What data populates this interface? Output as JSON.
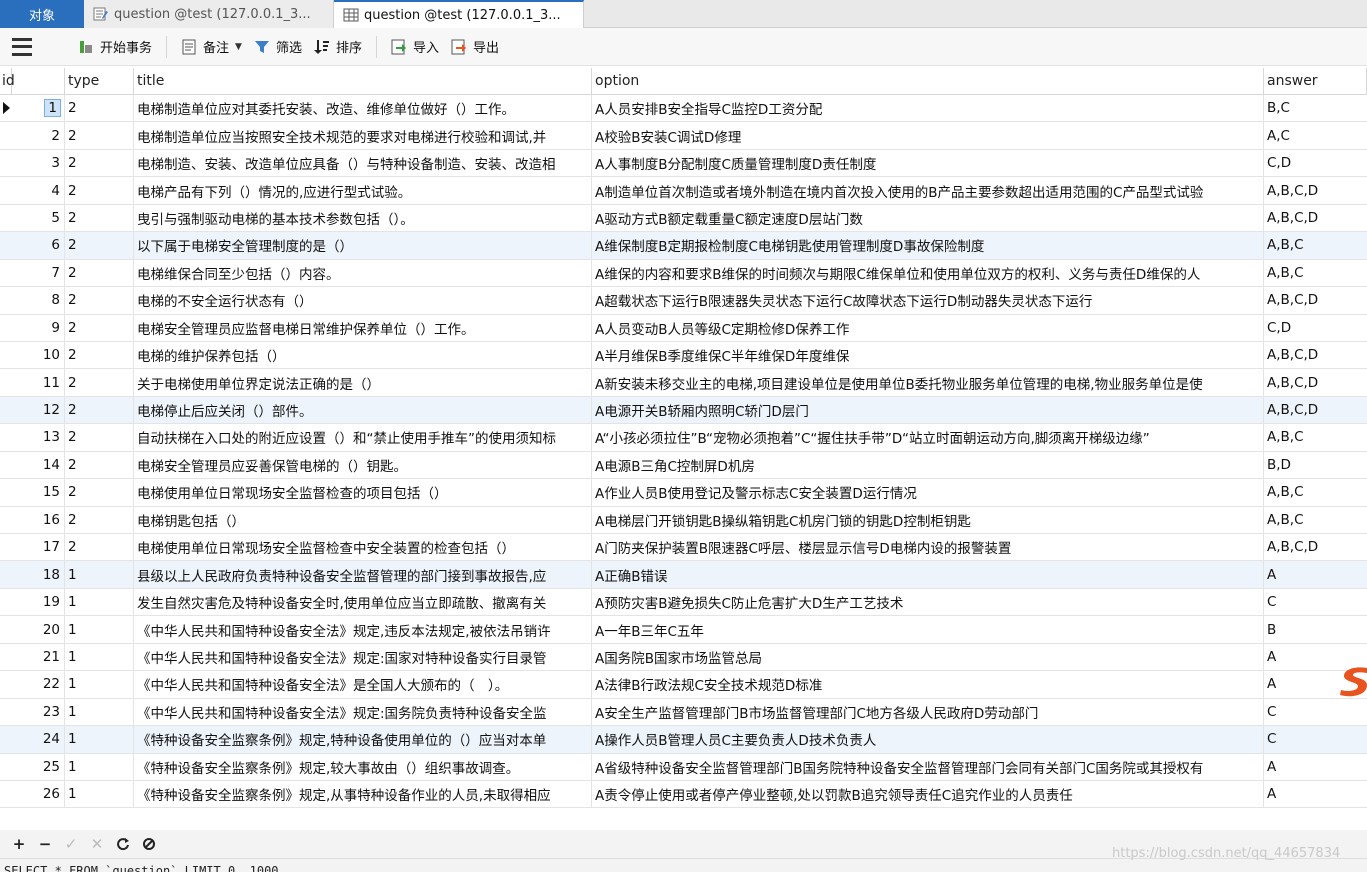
{
  "tabs": [
    {
      "label": "对象"
    },
    {
      "label": "question @test (127.0.0.1_3..."
    },
    {
      "label": "question @test (127.0.0.1_3..."
    }
  ],
  "toolbar": {
    "begin_transaction": "开始事务",
    "memo": "备注",
    "filter": "筛选",
    "sort": "排序",
    "import": "导入",
    "export": "导出"
  },
  "columns": [
    "id",
    "type",
    "title",
    "option",
    "answer"
  ],
  "rows": [
    {
      "id": "1",
      "type": "2",
      "title": "电梯制造单位应对其委托安装、改造、维修单位做好（）工作。",
      "option": "A人员安排B安全指导C监控D工资分配",
      "answer": "B,C"
    },
    {
      "id": "2",
      "type": "2",
      "title": "电梯制造单位应当按照安全技术规范的要求对电梯进行校验和调试,并",
      "option": "A校验B安装C调试D修理",
      "answer": "A,C"
    },
    {
      "id": "3",
      "type": "2",
      "title": "电梯制造、安装、改造单位应具备（）与特种设备制造、安装、改造相",
      "option": "A人事制度B分配制度C质量管理制度D责任制度",
      "answer": "C,D"
    },
    {
      "id": "4",
      "type": "2",
      "title": "电梯产品有下列（）情况的,应进行型式试验。",
      "option": "A制造单位首次制造或者境外制造在境内首次投入使用的B产品主要参数超出适用范围的C产品型式试验",
      "answer": "A,B,C,D"
    },
    {
      "id": "5",
      "type": "2",
      "title": "曳引与强制驱动电梯的基本技术参数包括（）。",
      "option": "A驱动方式B额定载重量C额定速度D层站门数",
      "answer": "A,B,C,D"
    },
    {
      "id": "6",
      "type": "2",
      "title": "以下属于电梯安全管理制度的是（）",
      "option": "A维保制度B定期报检制度C电梯钥匙使用管理制度D事故保险制度",
      "answer": "A,B,C"
    },
    {
      "id": "7",
      "type": "2",
      "title": "电梯维保合同至少包括（）内容。",
      "option": "A维保的内容和要求B维保的时间频次与期限C维保单位和使用单位双方的权利、义务与责任D维保的人",
      "answer": "A,B,C"
    },
    {
      "id": "8",
      "type": "2",
      "title": "电梯的不安全运行状态有（）",
      "option": "A超载状态下运行B限速器失灵状态下运行C故障状态下运行D制动器失灵状态下运行",
      "answer": "A,B,C,D"
    },
    {
      "id": "9",
      "type": "2",
      "title": "电梯安全管理员应监督电梯日常维护保养单位（）工作。",
      "option": "A人员变动B人员等级C定期检修D保养工作",
      "answer": "C,D"
    },
    {
      "id": "10",
      "type": "2",
      "title": "电梯的维护保养包括（）",
      "option": "A半月维保B季度维保C半年维保D年度维保",
      "answer": "A,B,C,D"
    },
    {
      "id": "11",
      "type": "2",
      "title": "关于电梯使用单位界定说法正确的是（）",
      "option": "A新安装未移交业主的电梯,项目建设单位是使用单位B委托物业服务单位管理的电梯,物业服务单位是使",
      "answer": "A,B,C,D"
    },
    {
      "id": "12",
      "type": "2",
      "title": "电梯停止后应关闭（）部件。",
      "option": "A电源开关B轿厢内照明C轿门D层门",
      "answer": "A,B,C,D"
    },
    {
      "id": "13",
      "type": "2",
      "title": "自动扶梯在入口处的附近应设置（）和“禁止使用手推车”的使用须知标",
      "option": "A“小孩必须拉住”B“宠物必须抱着”C“握住扶手带”D“站立时面朝运动方向,脚须离开梯级边缘”",
      "answer": "A,B,C"
    },
    {
      "id": "14",
      "type": "2",
      "title": "电梯安全管理员应妥善保管电梯的（）钥匙。",
      "option": "A电源B三角C控制屏D机房",
      "answer": "B,D"
    },
    {
      "id": "15",
      "type": "2",
      "title": "电梯使用单位日常现场安全监督检查的项目包括（）",
      "option": "A作业人员B使用登记及警示标志C安全装置D运行情况",
      "answer": "A,B,C"
    },
    {
      "id": "16",
      "type": "2",
      "title": "电梯钥匙包括（）",
      "option": "A电梯层门开锁钥匙B操纵箱钥匙C机房门锁的钥匙D控制柜钥匙",
      "answer": "A,B,C"
    },
    {
      "id": "17",
      "type": "2",
      "title": "电梯使用单位日常现场安全监督检查中安全装置的检查包括（）",
      "option": "A门防夹保护装置B限速器C呼层、楼层显示信号D电梯内设的报警装置",
      "answer": "A,B,C,D"
    },
    {
      "id": "18",
      "type": "1",
      "title": "县级以上人民政府负责特种设备安全监督管理的部门接到事故报告,应",
      "option": "A正确B错误",
      "answer": "A"
    },
    {
      "id": "19",
      "type": "1",
      "title": "发生自然灾害危及特种设备安全时,使用单位应当立即疏散、撤离有关",
      "option": "A预防灾害B避免损失C防止危害扩大D生产工艺技术",
      "answer": "C"
    },
    {
      "id": "20",
      "type": "1",
      "title": "《中华人民共和国特种设备安全法》规定,违反本法规定,被依法吊销许",
      "option": "A一年B三年C五年",
      "answer": "B"
    },
    {
      "id": "21",
      "type": "1",
      "title": "《中华人民共和国特种设备安全法》规定:国家对特种设备实行目录管",
      "option": "A国务院B国家市场监管总局",
      "answer": "A"
    },
    {
      "id": "22",
      "type": "1",
      "title": "《中华人民共和国特种设备安全法》是全国人大颁布的（　）。",
      "option": "A法律B行政法规C安全技术规范D标准",
      "answer": "A"
    },
    {
      "id": "23",
      "type": "1",
      "title": "《中华人民共和国特种设备安全法》规定:国务院负责特种设备安全监",
      "option": "A安全生产监督管理部门B市场监督管理部门C地方各级人民政府D劳动部门",
      "answer": "C"
    },
    {
      "id": "24",
      "type": "1",
      "title": "《特种设备安全监察条例》规定,特种设备使用单位的（）应当对本单",
      "option": "A操作人员B管理人员C主要负责人D技术负责人",
      "answer": "C"
    },
    {
      "id": "25",
      "type": "1",
      "title": "《特种设备安全监察条例》规定,较大事故由（）组织事故调查。",
      "option": "A省级特种设备安全监督管理部门B国务院特种设备安全监督管理部门会同有关部门C国务院或其授权有",
      "answer": "A"
    },
    {
      "id": "26",
      "type": "1",
      "title": "《特种设备安全监察条例》规定,从事特种设备作业的人员,未取得相应",
      "option": "A责令停止使用或者停产停业整顿,处以罚款B追究领导责任C追究作业的人员责任",
      "answer": "A"
    }
  ],
  "sql": "SELECT * FROM `question` LIMIT 0, 1000",
  "watermark": "https://blog.csdn.net/qq_44657834",
  "colors": {
    "accent": "#2a6fbe",
    "alt_row": "#eef4fb",
    "logo": "#e8531f"
  }
}
